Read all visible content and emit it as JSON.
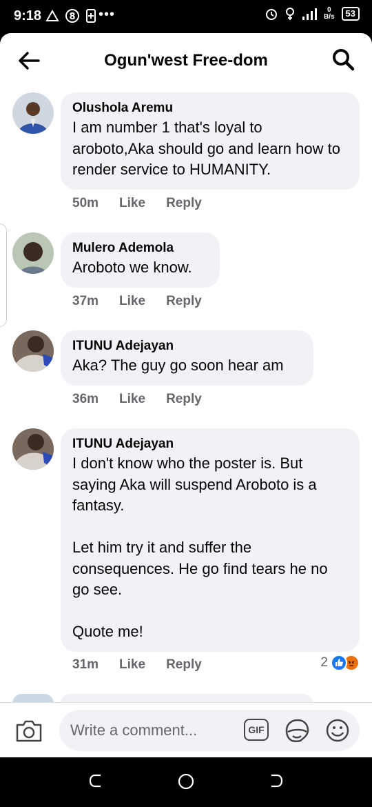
{
  "status_bar": {
    "time": "9:18",
    "net_speed_value": "0",
    "net_speed_unit": "B/s",
    "battery": "53"
  },
  "header": {
    "title": "Ogun'west Free-dom"
  },
  "comments": [
    {
      "name": "Olushola Aremu",
      "text": "I am number 1 that's loyal to aroboto,Aka should go and learn how to render service to HUMANITY.",
      "time": "50m",
      "like": "Like",
      "reply": "Reply"
    },
    {
      "name": "Mulero Ademola",
      "text": "Aroboto we know.",
      "time": "37m",
      "like": "Like",
      "reply": "Reply"
    },
    {
      "name": "ITUNU Adejayan",
      "text": "Aka? The guy go soon hear am",
      "time": "36m",
      "like": "Like",
      "reply": "Reply"
    },
    {
      "name": "ITUNU Adejayan",
      "text": "I don't know who the poster is. But saying Aka will suspend Aroboto is a fantasy.\n\nLet him try it and suffer the consequences. He go find tears he no go see.\n\nQuote me!",
      "time": "31m",
      "like": "Like",
      "reply": "Reply",
      "reaction_count": "2"
    }
  ],
  "composer": {
    "placeholder": "Write a comment...",
    "gif_label": "GIF"
  },
  "colors": {
    "bubble": "#f0f2f5",
    "meta_text": "#65676b",
    "like_blue": "#1877f2",
    "angry_orange": "#e9710f"
  }
}
